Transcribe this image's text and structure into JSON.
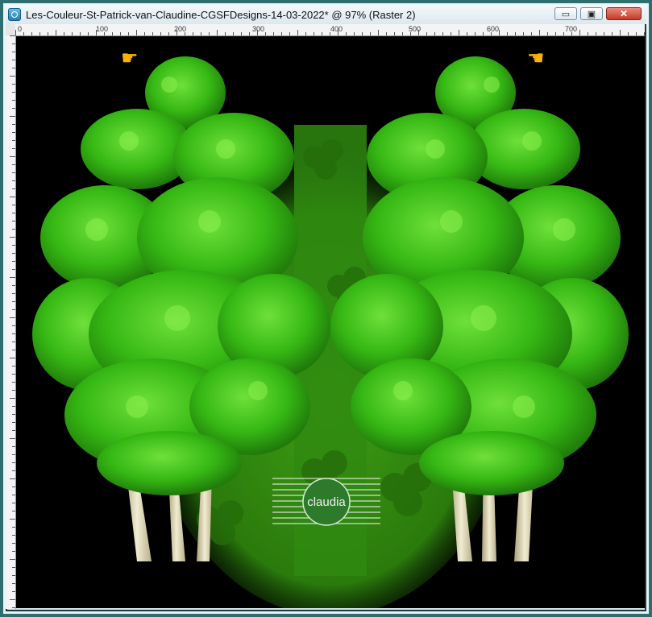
{
  "window": {
    "title": "Les-Couleur-St-Patrick-van-Claudine-CGSFDesigns-14-03-2022* @  97% (Raster 2)",
    "buttons": {
      "minimize": "▭",
      "maximize": "▣",
      "close": "✕"
    }
  },
  "ruler": {
    "labels": [
      "0",
      "100",
      "200",
      "300",
      "400",
      "500",
      "600",
      "700"
    ]
  },
  "canvas": {
    "watermark_text": "claudia",
    "colors": {
      "background": "#000000",
      "foliage": "#3fc21a",
      "floor": "#2f8a10"
    }
  },
  "icons": {
    "left_pointer": "pointing-hand-icon",
    "right_pointer": "pointing-hand-icon"
  }
}
